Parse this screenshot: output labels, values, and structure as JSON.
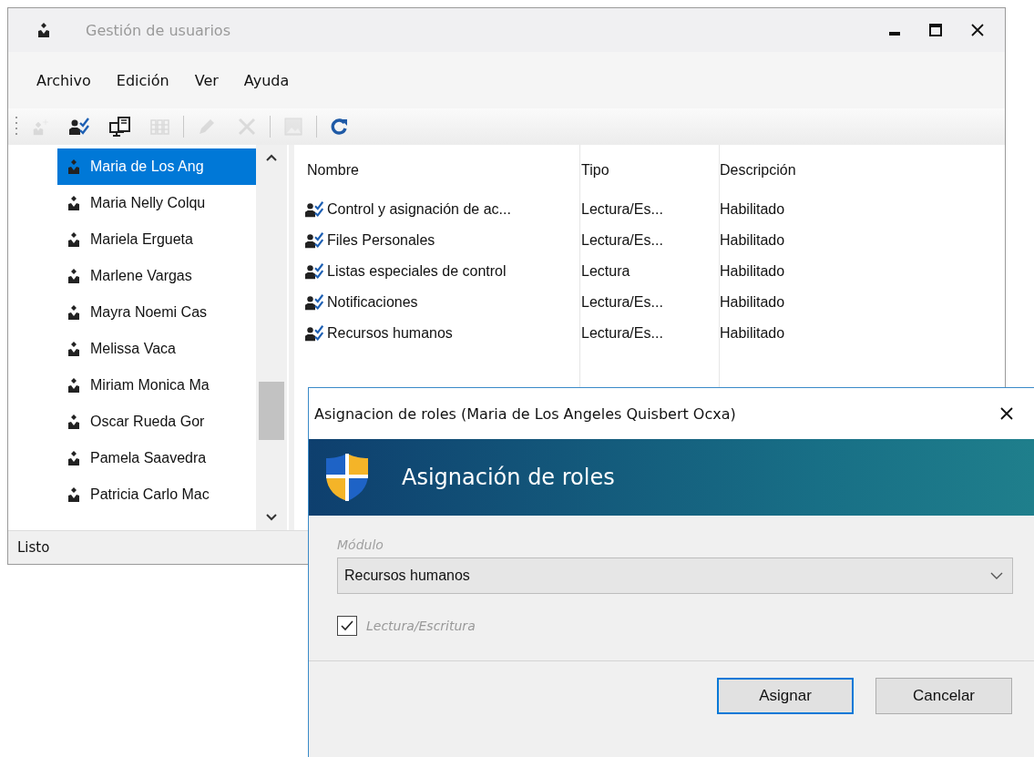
{
  "window": {
    "title": "Gestión de usuarios"
  },
  "menu": [
    {
      "label": "Archivo"
    },
    {
      "label": "Edición"
    },
    {
      "label": "Ver"
    },
    {
      "label": "Ayuda"
    }
  ],
  "toolbar": [
    {
      "kind": "button",
      "disabled": true
    },
    {
      "kind": "button",
      "disabled": false
    },
    {
      "kind": "button",
      "disabled": false
    },
    {
      "kind": "button",
      "disabled": true
    },
    {
      "kind": "separator"
    },
    {
      "kind": "button",
      "disabled": true
    },
    {
      "kind": "button",
      "disabled": true
    },
    {
      "kind": "separator"
    },
    {
      "kind": "button",
      "disabled": true
    },
    {
      "kind": "separator"
    },
    {
      "kind": "button",
      "disabled": false
    }
  ],
  "users": [
    {
      "name": "Maria de Los Ang",
      "selected": true
    },
    {
      "name": "Maria Nelly Colqu",
      "selected": false
    },
    {
      "name": "Mariela Ergueta",
      "selected": false
    },
    {
      "name": "Marlene Vargas",
      "selected": false
    },
    {
      "name": "Mayra Noemi Cas",
      "selected": false
    },
    {
      "name": "Melissa Vaca",
      "selected": false
    },
    {
      "name": "Miriam Monica Ma",
      "selected": false
    },
    {
      "name": "Oscar Rueda Gor",
      "selected": false
    },
    {
      "name": "Pamela Saavedra",
      "selected": false
    },
    {
      "name": "Patricia Carlo Mac",
      "selected": false
    }
  ],
  "roles_table": {
    "columns": [
      "Nombre",
      "Tipo",
      "Descripción"
    ],
    "rows": [
      {
        "name": "Control y asignación de ac...",
        "type": "Lectura/Es...",
        "description": "Habilitado"
      },
      {
        "name": "Files Personales",
        "type": "Lectura/Es...",
        "description": "Habilitado"
      },
      {
        "name": "Listas especiales de control",
        "type": "Lectura",
        "description": "Habilitado"
      },
      {
        "name": "Notificaciones",
        "type": "Lectura/Es...",
        "description": "Habilitado"
      },
      {
        "name": "Recursos humanos",
        "type": "Lectura/Es...",
        "description": "Habilitado"
      }
    ]
  },
  "status_bar": "Listo",
  "dialog": {
    "title": "Asignacion de roles (Maria de Los Angeles Quisbert  Ocxa)",
    "heading": "Asignación de roles",
    "field_label": "Módulo",
    "module": "Recursos humanos",
    "checkbox": {
      "label": "Lectura/Escritura",
      "checked": true
    },
    "buttons": [
      {
        "label": "Asignar",
        "default": true
      },
      {
        "label": "Cancelar",
        "default": false
      }
    ]
  }
}
